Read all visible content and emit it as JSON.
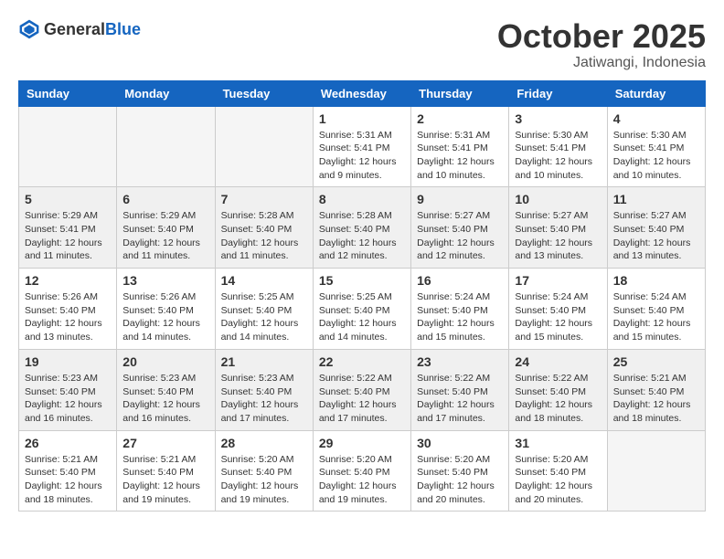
{
  "header": {
    "logo_general": "General",
    "logo_blue": "Blue",
    "month": "October 2025",
    "location": "Jatiwangi, Indonesia"
  },
  "days_of_week": [
    "Sunday",
    "Monday",
    "Tuesday",
    "Wednesday",
    "Thursday",
    "Friday",
    "Saturday"
  ],
  "rows": [
    [
      {
        "day": "",
        "empty": true
      },
      {
        "day": "",
        "empty": true
      },
      {
        "day": "",
        "empty": true
      },
      {
        "day": "1",
        "sunrise": "Sunrise: 5:31 AM",
        "sunset": "Sunset: 5:41 PM",
        "daylight": "Daylight: 12 hours and 9 minutes."
      },
      {
        "day": "2",
        "sunrise": "Sunrise: 5:31 AM",
        "sunset": "Sunset: 5:41 PM",
        "daylight": "Daylight: 12 hours and 10 minutes."
      },
      {
        "day": "3",
        "sunrise": "Sunrise: 5:30 AM",
        "sunset": "Sunset: 5:41 PM",
        "daylight": "Daylight: 12 hours and 10 minutes."
      },
      {
        "day": "4",
        "sunrise": "Sunrise: 5:30 AM",
        "sunset": "Sunset: 5:41 PM",
        "daylight": "Daylight: 12 hours and 10 minutes."
      }
    ],
    [
      {
        "day": "5",
        "sunrise": "Sunrise: 5:29 AM",
        "sunset": "Sunset: 5:41 PM",
        "daylight": "Daylight: 12 hours and 11 minutes."
      },
      {
        "day": "6",
        "sunrise": "Sunrise: 5:29 AM",
        "sunset": "Sunset: 5:40 PM",
        "daylight": "Daylight: 12 hours and 11 minutes."
      },
      {
        "day": "7",
        "sunrise": "Sunrise: 5:28 AM",
        "sunset": "Sunset: 5:40 PM",
        "daylight": "Daylight: 12 hours and 11 minutes."
      },
      {
        "day": "8",
        "sunrise": "Sunrise: 5:28 AM",
        "sunset": "Sunset: 5:40 PM",
        "daylight": "Daylight: 12 hours and 12 minutes."
      },
      {
        "day": "9",
        "sunrise": "Sunrise: 5:27 AM",
        "sunset": "Sunset: 5:40 PM",
        "daylight": "Daylight: 12 hours and 12 minutes."
      },
      {
        "day": "10",
        "sunrise": "Sunrise: 5:27 AM",
        "sunset": "Sunset: 5:40 PM",
        "daylight": "Daylight: 12 hours and 13 minutes."
      },
      {
        "day": "11",
        "sunrise": "Sunrise: 5:27 AM",
        "sunset": "Sunset: 5:40 PM",
        "daylight": "Daylight: 12 hours and 13 minutes."
      }
    ],
    [
      {
        "day": "12",
        "sunrise": "Sunrise: 5:26 AM",
        "sunset": "Sunset: 5:40 PM",
        "daylight": "Daylight: 12 hours and 13 minutes."
      },
      {
        "day": "13",
        "sunrise": "Sunrise: 5:26 AM",
        "sunset": "Sunset: 5:40 PM",
        "daylight": "Daylight: 12 hours and 14 minutes."
      },
      {
        "day": "14",
        "sunrise": "Sunrise: 5:25 AM",
        "sunset": "Sunset: 5:40 PM",
        "daylight": "Daylight: 12 hours and 14 minutes."
      },
      {
        "day": "15",
        "sunrise": "Sunrise: 5:25 AM",
        "sunset": "Sunset: 5:40 PM",
        "daylight": "Daylight: 12 hours and 14 minutes."
      },
      {
        "day": "16",
        "sunrise": "Sunrise: 5:24 AM",
        "sunset": "Sunset: 5:40 PM",
        "daylight": "Daylight: 12 hours and 15 minutes."
      },
      {
        "day": "17",
        "sunrise": "Sunrise: 5:24 AM",
        "sunset": "Sunset: 5:40 PM",
        "daylight": "Daylight: 12 hours and 15 minutes."
      },
      {
        "day": "18",
        "sunrise": "Sunrise: 5:24 AM",
        "sunset": "Sunset: 5:40 PM",
        "daylight": "Daylight: 12 hours and 15 minutes."
      }
    ],
    [
      {
        "day": "19",
        "sunrise": "Sunrise: 5:23 AM",
        "sunset": "Sunset: 5:40 PM",
        "daylight": "Daylight: 12 hours and 16 minutes."
      },
      {
        "day": "20",
        "sunrise": "Sunrise: 5:23 AM",
        "sunset": "Sunset: 5:40 PM",
        "daylight": "Daylight: 12 hours and 16 minutes."
      },
      {
        "day": "21",
        "sunrise": "Sunrise: 5:23 AM",
        "sunset": "Sunset: 5:40 PM",
        "daylight": "Daylight: 12 hours and 17 minutes."
      },
      {
        "day": "22",
        "sunrise": "Sunrise: 5:22 AM",
        "sunset": "Sunset: 5:40 PM",
        "daylight": "Daylight: 12 hours and 17 minutes."
      },
      {
        "day": "23",
        "sunrise": "Sunrise: 5:22 AM",
        "sunset": "Sunset: 5:40 PM",
        "daylight": "Daylight: 12 hours and 17 minutes."
      },
      {
        "day": "24",
        "sunrise": "Sunrise: 5:22 AM",
        "sunset": "Sunset: 5:40 PM",
        "daylight": "Daylight: 12 hours and 18 minutes."
      },
      {
        "day": "25",
        "sunrise": "Sunrise: 5:21 AM",
        "sunset": "Sunset: 5:40 PM",
        "daylight": "Daylight: 12 hours and 18 minutes."
      }
    ],
    [
      {
        "day": "26",
        "sunrise": "Sunrise: 5:21 AM",
        "sunset": "Sunset: 5:40 PM",
        "daylight": "Daylight: 12 hours and 18 minutes."
      },
      {
        "day": "27",
        "sunrise": "Sunrise: 5:21 AM",
        "sunset": "Sunset: 5:40 PM",
        "daylight": "Daylight: 12 hours and 19 minutes."
      },
      {
        "day": "28",
        "sunrise": "Sunrise: 5:20 AM",
        "sunset": "Sunset: 5:40 PM",
        "daylight": "Daylight: 12 hours and 19 minutes."
      },
      {
        "day": "29",
        "sunrise": "Sunrise: 5:20 AM",
        "sunset": "Sunset: 5:40 PM",
        "daylight": "Daylight: 12 hours and 19 minutes."
      },
      {
        "day": "30",
        "sunrise": "Sunrise: 5:20 AM",
        "sunset": "Sunset: 5:40 PM",
        "daylight": "Daylight: 12 hours and 20 minutes."
      },
      {
        "day": "31",
        "sunrise": "Sunrise: 5:20 AM",
        "sunset": "Sunset: 5:40 PM",
        "daylight": "Daylight: 12 hours and 20 minutes."
      },
      {
        "day": "",
        "empty": true
      }
    ]
  ]
}
